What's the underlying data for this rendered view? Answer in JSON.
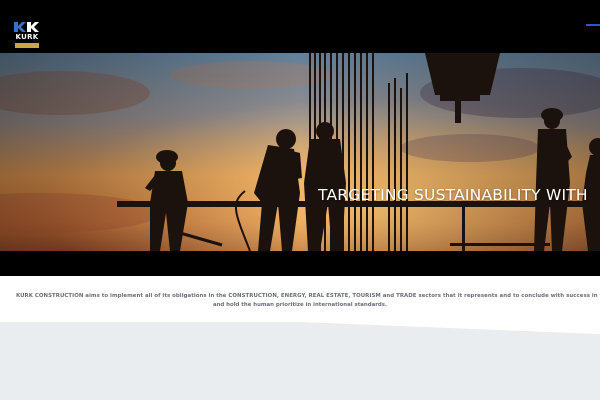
{
  "header": {
    "logo": {
      "word": "KURK"
    }
  },
  "hero": {
    "title": "TARGETING SUSTAINABILITY WITH"
  },
  "intro": {
    "line1": "KURK CONSTRUCTION aims to implement all of its obligations in the CONSTRUCTION, ENERGY, REAL ESTATE, TOURISM and TRADE sectors that it represents and to conclude with success in terms of quality policy. With its",
    "line2": "and hold the human prioritize in international standards."
  },
  "colors": {
    "header_bg": "#000000",
    "sky_top": "#5f7d95",
    "sky_sunset": "#f0a24d",
    "silhouette": "#1c120d",
    "text_muted": "#6a6e74",
    "lower_band": "#e9edf0"
  }
}
